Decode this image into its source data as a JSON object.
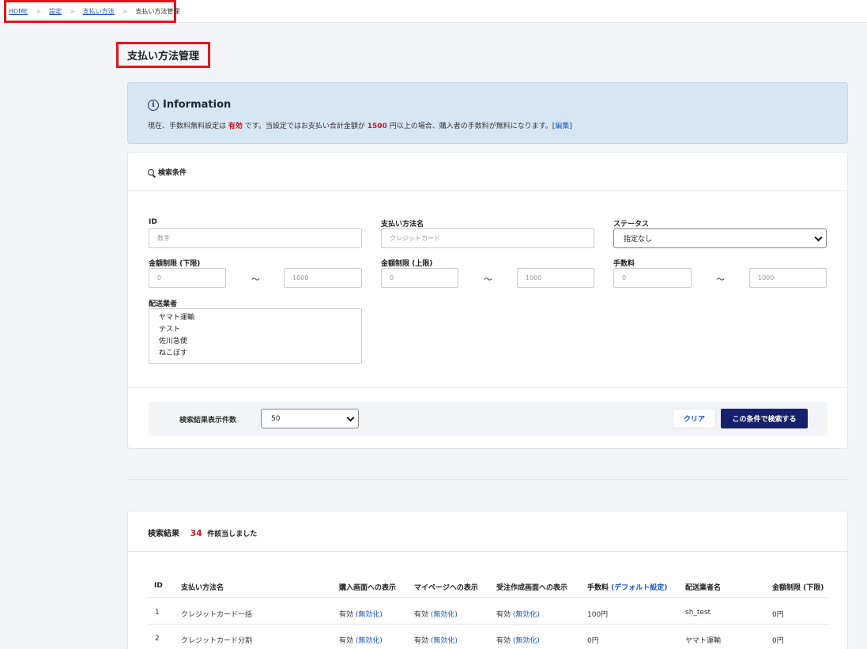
{
  "breadcrumb": {
    "items": [
      {
        "label": "HOME"
      },
      {
        "label": "設定"
      },
      {
        "label": "支払い方法"
      }
    ],
    "separator": ">",
    "current": "支払い方法管理"
  },
  "page": {
    "title": "支払い方法管理"
  },
  "info": {
    "heading": "Information",
    "icon": "info-icon",
    "text_1": "現在、手数料無料設定は",
    "status": "有効",
    "text_2": "です。当設定ではお支払い合計金額が",
    "amount": "1500",
    "text_3": "円以上の場合、購入者の手数料が無料になります。[",
    "edit_link": "編集",
    "text_4": "]"
  },
  "search": {
    "heading": "検索条件",
    "icon": "search-icon",
    "fields": {
      "id": {
        "label": "ID",
        "placeholder": "数字"
      },
      "name": {
        "label": "支払い方法名",
        "placeholder": "クレジットカード"
      },
      "status": {
        "label": "ステータス",
        "value": "指定なし"
      },
      "min_lower": {
        "label": "金額制限 (下限)",
        "from": "0",
        "to": "1000"
      },
      "min_upper": {
        "label": "金額制限 (上限)",
        "from": "0",
        "to": "1000"
      },
      "fee": {
        "label": "手数料",
        "from": "0",
        "to": "1000"
      }
    },
    "tilde": "～",
    "carrier": {
      "label": "配送業者",
      "options": [
        "ヤマト運輸",
        "テスト",
        "佐川急便",
        "ねこぽす"
      ]
    },
    "per_page": {
      "label": "検索結果表示件数",
      "value": "50"
    },
    "clear_button": "クリア",
    "search_button": "この条件で検索する"
  },
  "results": {
    "heading": "検索結果",
    "count": "34",
    "count_suffix": "件該当しました",
    "columns": [
      "ID",
      "支払い方法名",
      "購入画面への表示",
      "マイページへの表示",
      "受注作成画面への表示",
      "手数料",
      "(デフォルト設定)",
      "配送業者名",
      "金額制限 (下限)"
    ],
    "rows": [
      {
        "id": "1",
        "name": "クレジットカード一括",
        "purchase": "有効",
        "purchase_link": "(無効化)",
        "mypage": "有効",
        "mypage_link": "(無効化)",
        "order": "有効",
        "order_link": "(無効化)",
        "fee": "100円",
        "carrier": "sh_test",
        "min": "0円"
      },
      {
        "id": "2",
        "name": "クレジットカード分割",
        "purchase": "有効",
        "purchase_link": "(無効化)",
        "mypage": "有効",
        "mypage_link": "(無効化)",
        "order": "有効",
        "order_link": "(無効化)",
        "fee": "0円",
        "carrier": "ヤマト運輸",
        "min": "0円"
      }
    ]
  }
}
